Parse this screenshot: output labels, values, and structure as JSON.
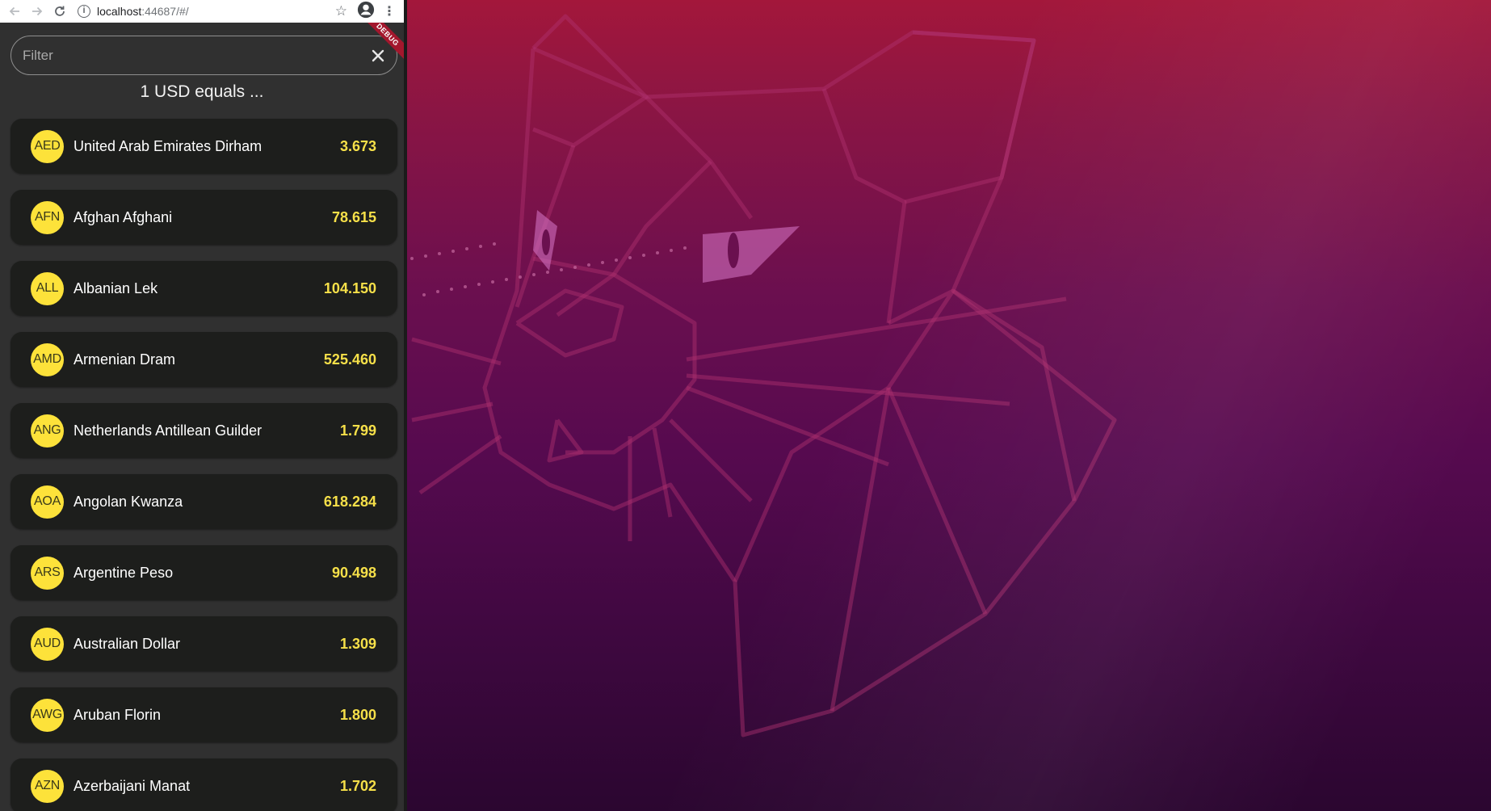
{
  "browser": {
    "url_host": "localhost",
    "url_rest": ":44687/#/"
  },
  "app": {
    "debug_label": "DEBUG",
    "filter": {
      "placeholder": "Filter",
      "value": ""
    },
    "heading": "1 USD equals ...",
    "rates": [
      {
        "code": "AED",
        "name": "United Arab Emirates Dirham",
        "rate": "3.673"
      },
      {
        "code": "AFN",
        "name": "Afghan Afghani",
        "rate": "78.615"
      },
      {
        "code": "ALL",
        "name": "Albanian Lek",
        "rate": "104.150"
      },
      {
        "code": "AMD",
        "name": "Armenian Dram",
        "rate": "525.460"
      },
      {
        "code": "ANG",
        "name": "Netherlands Antillean Guilder",
        "rate": "1.799"
      },
      {
        "code": "AOA",
        "name": "Angolan Kwanza",
        "rate": "618.284"
      },
      {
        "code": "ARS",
        "name": "Argentine Peso",
        "rate": "90.498"
      },
      {
        "code": "AUD",
        "name": "Australian Dollar",
        "rate": "1.309"
      },
      {
        "code": "AWG",
        "name": "Aruban Florin",
        "rate": "1.800"
      },
      {
        "code": "AZN",
        "name": "Azerbaijani Manat",
        "rate": "1.702"
      }
    ]
  },
  "colors": {
    "accent_yellow": "#fde23a",
    "rate_text": "#f6e049",
    "card_background": "#1d1e1c",
    "app_background": "#303030",
    "debug_banner": "#a3172d"
  },
  "icons": {
    "back": "arrow-left-icon",
    "forward": "arrow-right-icon",
    "reload": "reload-icon",
    "site_info": "info-icon",
    "bookmark": "star-icon",
    "profile": "account-circle-icon",
    "menu": "kebab-menu-icon",
    "clear_filter": "close-icon"
  }
}
